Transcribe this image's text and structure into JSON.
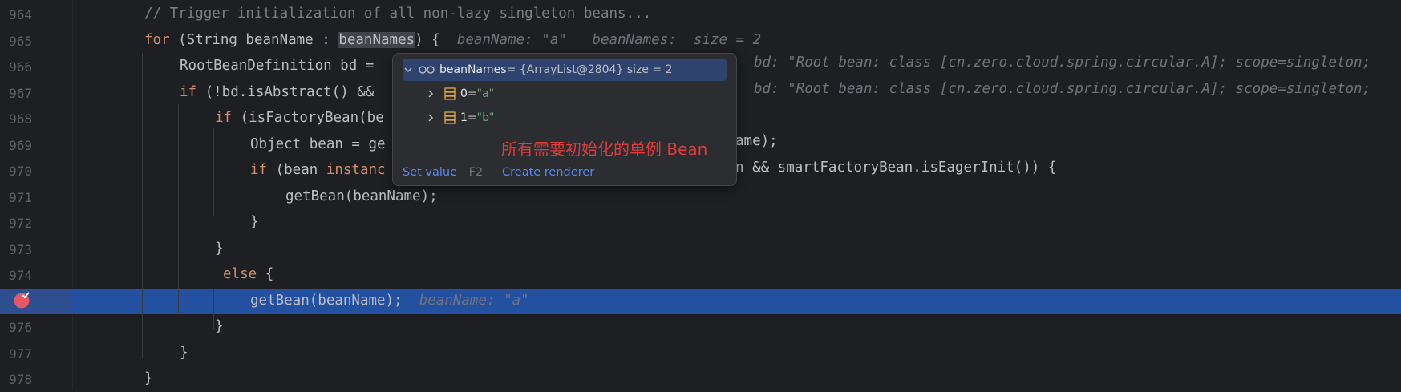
{
  "lines": [
    {
      "num": "964",
      "segments": [
        {
          "t": "// Trigger initialization of all non-lazy singleton beans...",
          "c": "cm"
        }
      ]
    },
    {
      "num": "965",
      "segments": [
        {
          "t": "for",
          "c": "kw"
        },
        {
          "t": " (String beanName : ",
          "c": ""
        },
        {
          "t": "beanNames",
          "c": "hl-word"
        },
        {
          "t": ") {  ",
          "c": ""
        },
        {
          "t": "beanName: \"a\"   beanNames:  size = 2",
          "c": "hint"
        }
      ]
    },
    {
      "num": "966",
      "segments": [
        {
          "t": "RootBeanDefinition bd = ",
          "c": ""
        }
      ]
    },
    {
      "num": "967",
      "segments": [
        {
          "t": "if",
          "c": "kw"
        },
        {
          "t": " (!bd.isAbstract() && ",
          "c": ""
        }
      ]
    },
    {
      "num": "968",
      "segments": [
        {
          "t": "if",
          "c": "kw"
        },
        {
          "t": " (isFactoryBean(be",
          "c": ""
        }
      ]
    },
    {
      "num": "969",
      "segments": [
        {
          "t": "Object bean = ge",
          "c": ""
        }
      ]
    },
    {
      "num": "970",
      "segments": [
        {
          "t": "if",
          "c": "kw"
        },
        {
          "t": " (bean ",
          "c": ""
        },
        {
          "t": "instanc",
          "c": "kw"
        }
      ]
    },
    {
      "num": "971",
      "segments": [
        {
          "t": "getBean(beanName);",
          "c": ""
        }
      ]
    },
    {
      "num": "972",
      "segments": [
        {
          "t": "}",
          "c": ""
        }
      ]
    },
    {
      "num": "973",
      "segments": [
        {
          "t": "}",
          "c": ""
        }
      ]
    },
    {
      "num": "974",
      "segments": [
        {
          "t": "else",
          "c": "kw"
        },
        {
          "t": " {",
          "c": ""
        }
      ]
    },
    {
      "num": "975",
      "segments": [
        {
          "t": "getBean(beanName);  ",
          "c": ""
        },
        {
          "t": "beanName: \"a\"",
          "c": "hint"
        }
      ]
    },
    {
      "num": "976",
      "segments": [
        {
          "t": "}",
          "c": ""
        }
      ]
    },
    {
      "num": "977",
      "segments": [
        {
          "t": "}",
          "c": ""
        }
      ]
    },
    {
      "num": "978",
      "segments": [
        {
          "t": "}",
          "c": ""
        }
      ]
    }
  ],
  "right_fragments": {
    "line966_hint": "bd: \"Root bean: class [cn.zero.cloud.spring.circular.A]; scope=singleton;",
    "line967_hint": "bd: \"Root bean: class [cn.zero.cloud.spring.circular.A]; scope=singleton;",
    "line969_tail": "ame);",
    "line970_tail": "n && smartFactoryBean.isEagerInit()) {"
  },
  "popup": {
    "root": {
      "name": "beanNames",
      "value": " = {ArrayList@2804}  size = 2"
    },
    "children": [
      {
        "index": "0",
        "eq": " = ",
        "value": "\"a\""
      },
      {
        "index": "1",
        "eq": " = ",
        "value": "\"b\""
      }
    ],
    "annotation": "所有需要初始化的单例 Bean",
    "set_value_label": "Set value",
    "set_value_shortcut": "F2",
    "create_renderer_label": "Create renderer"
  },
  "colors": {
    "background": "#1e1f22",
    "current_line": "#2350a0",
    "keyword": "#cf8e6d",
    "breakpoint": "#e55765",
    "annotation": "#e03c3c",
    "link": "#548af7"
  }
}
